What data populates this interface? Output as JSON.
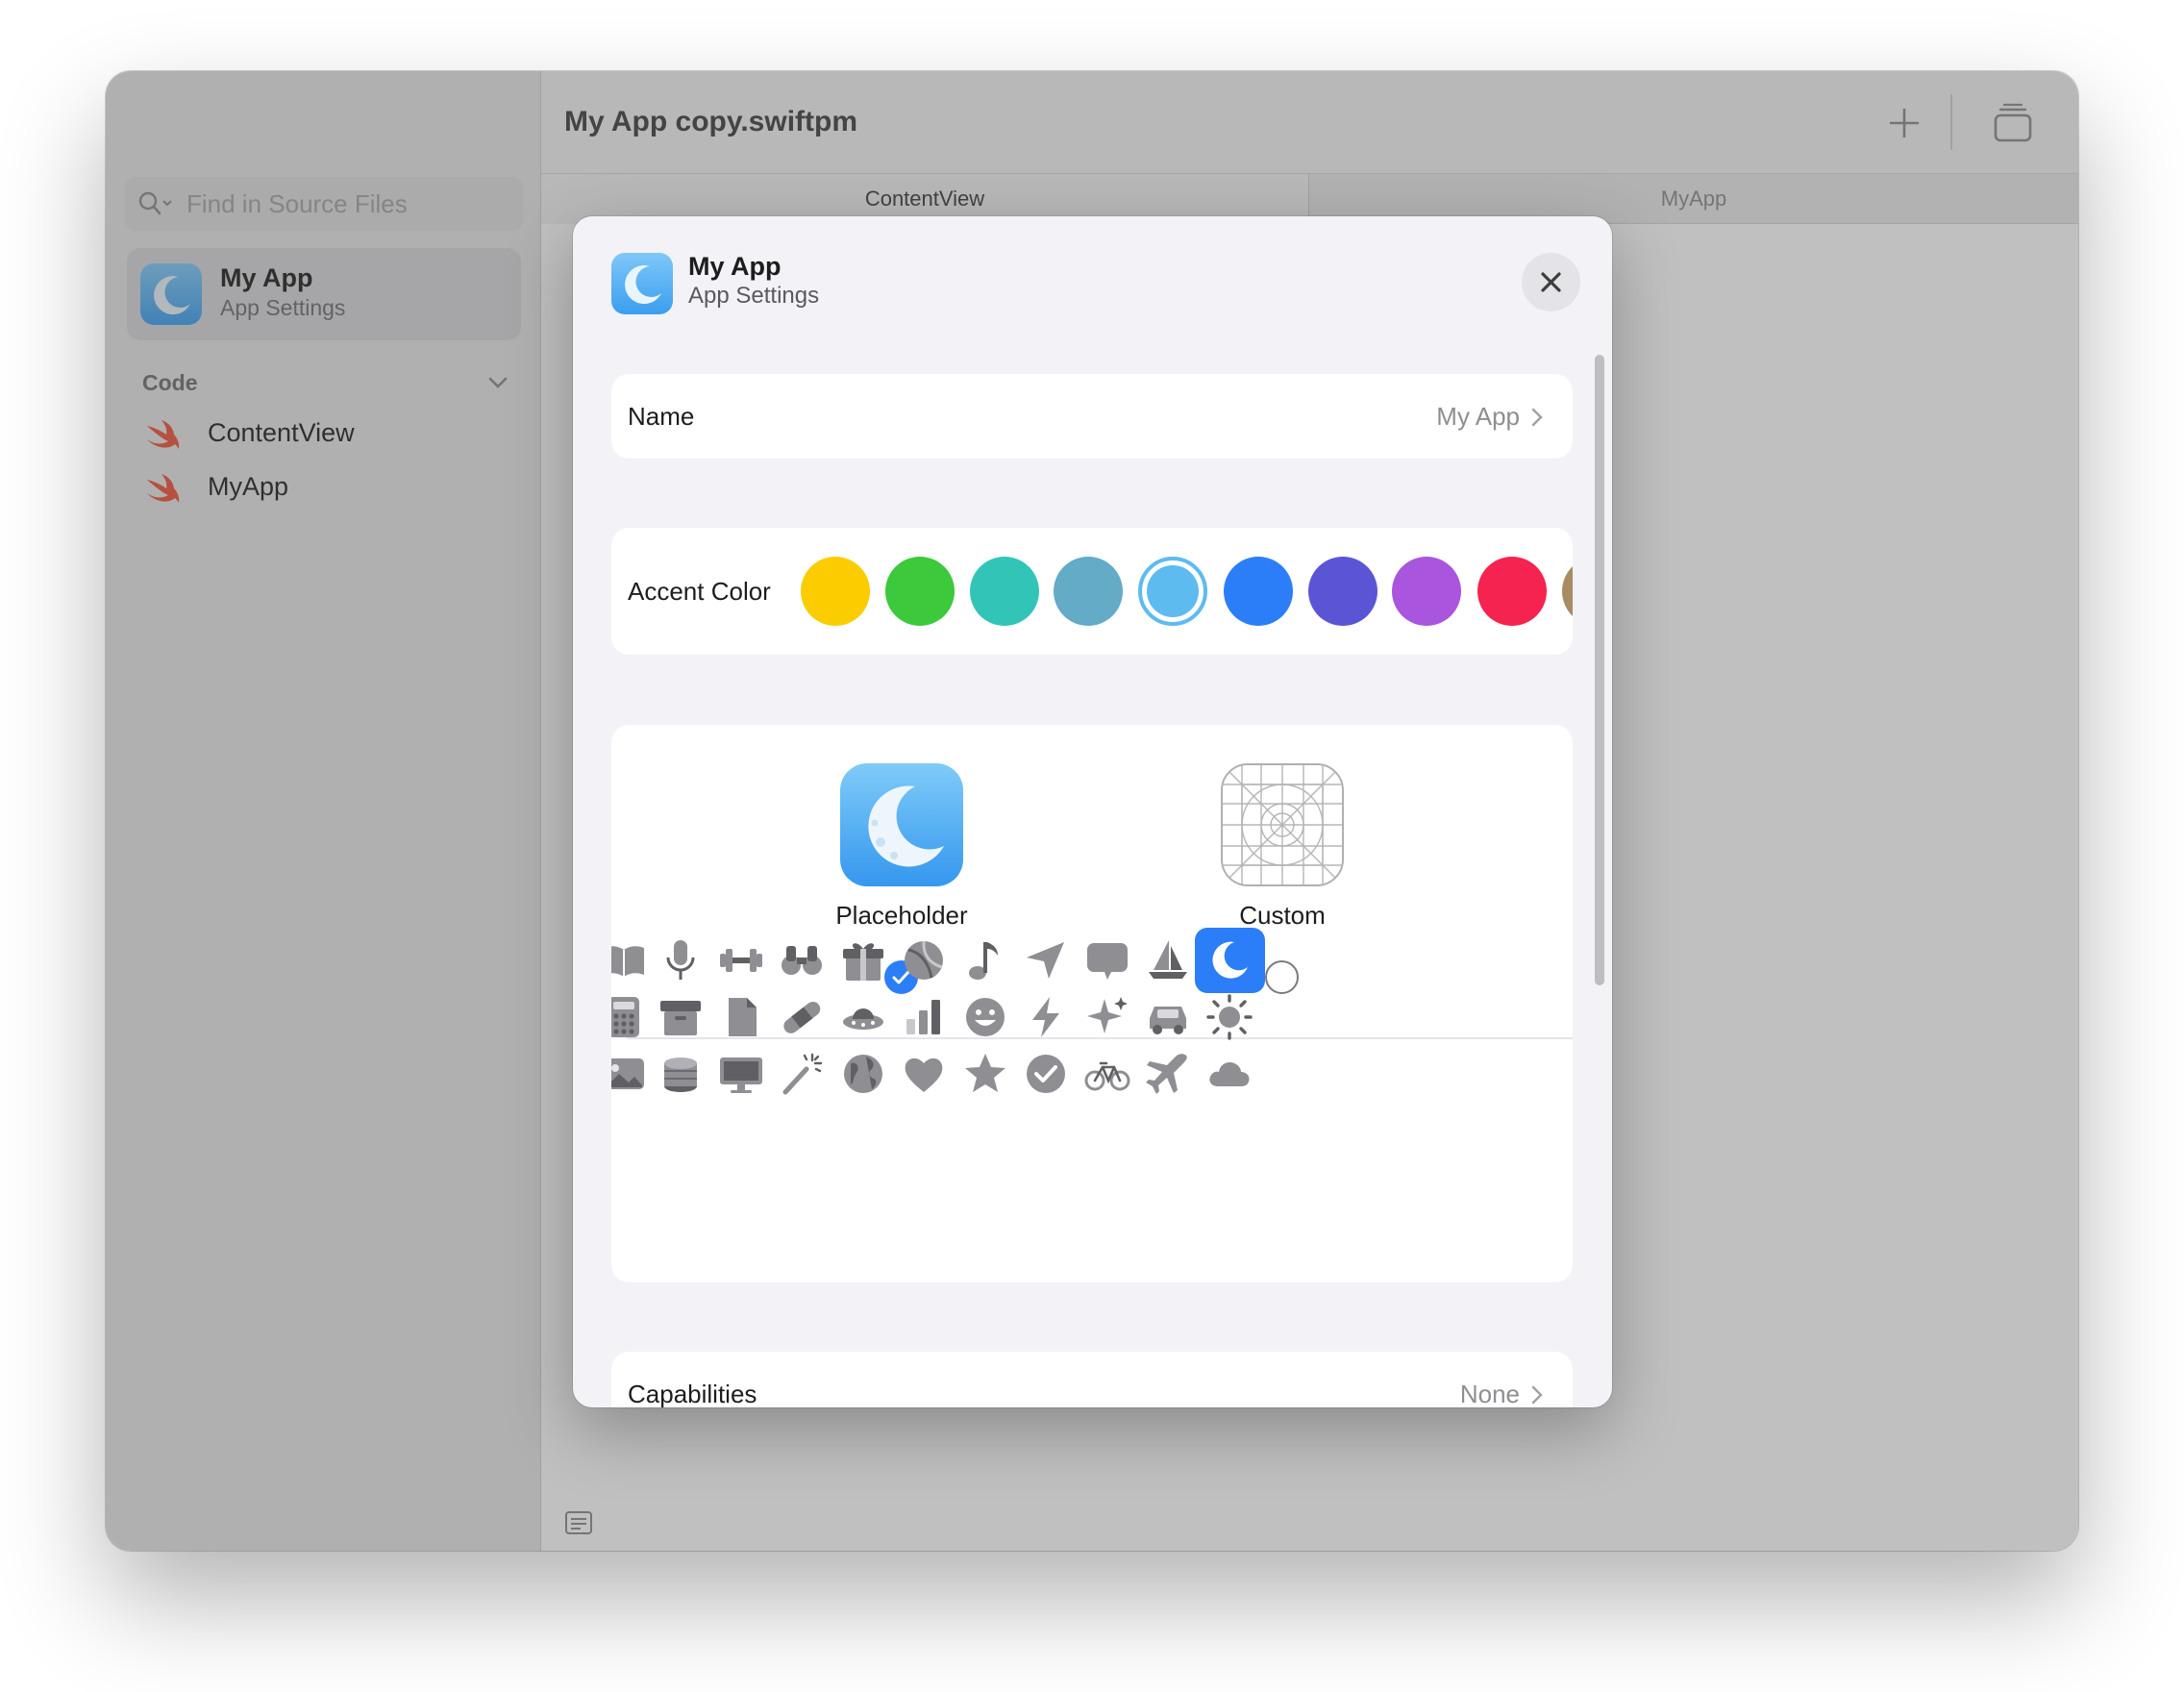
{
  "window": {
    "traffic_lights": {
      "close": "#c7c7c9",
      "minimize": "#febc2e",
      "zoom": "#28c840"
    },
    "title": "My App copy.swiftpm"
  },
  "sidebar": {
    "search": {
      "placeholder": "Find in Source Files"
    },
    "app": {
      "name": "My App",
      "subtitle": "App Settings"
    },
    "section": {
      "label": "Code"
    },
    "files": [
      {
        "label": "ContentView",
        "icon": "swift-icon"
      },
      {
        "label": "MyApp",
        "icon": "swift-icon"
      }
    ]
  },
  "tabs": [
    {
      "label": "ContentView"
    },
    {
      "label": "MyApp"
    }
  ],
  "sheet": {
    "header": {
      "title": "My App",
      "subtitle": "App Settings"
    },
    "name_row": {
      "label": "Name",
      "value": "My App"
    },
    "accent": {
      "label": "Accent Color",
      "selected": "#5ebbf0",
      "colors": [
        "#fbcc00",
        "#3cc93c",
        "#33c4b8",
        "#63abc7",
        "#5ebbf0",
        "#2b7ef7",
        "#5b55d6",
        "#aa55dd",
        "#f5234f",
        "#a88b63"
      ]
    },
    "icon_choice": {
      "options": [
        {
          "label": "Placeholder",
          "selected": true
        },
        {
          "label": "Custom",
          "selected": false
        }
      ]
    },
    "glyphs": [
      [
        "book",
        "microphone",
        "dumbbell",
        "binoculars",
        "gift",
        "beach-ball",
        "music-note",
        "location-arrow",
        "speech-bubble",
        "sailboat",
        "moon"
      ],
      [
        "calculator",
        "archive-box",
        "document",
        "bandage",
        "ufo",
        "bar-chart",
        "smiley",
        "lightning",
        "sparkles",
        "car",
        "sun"
      ],
      [
        "photo",
        "coins",
        "display",
        "magic-wand",
        "globe",
        "heart",
        "star",
        "checkmark-seal",
        "bicycle",
        "airplane",
        "cloud"
      ]
    ],
    "selected_glyph": "moon",
    "capabilities_row": {
      "label": "Capabilities",
      "value": "None"
    }
  }
}
